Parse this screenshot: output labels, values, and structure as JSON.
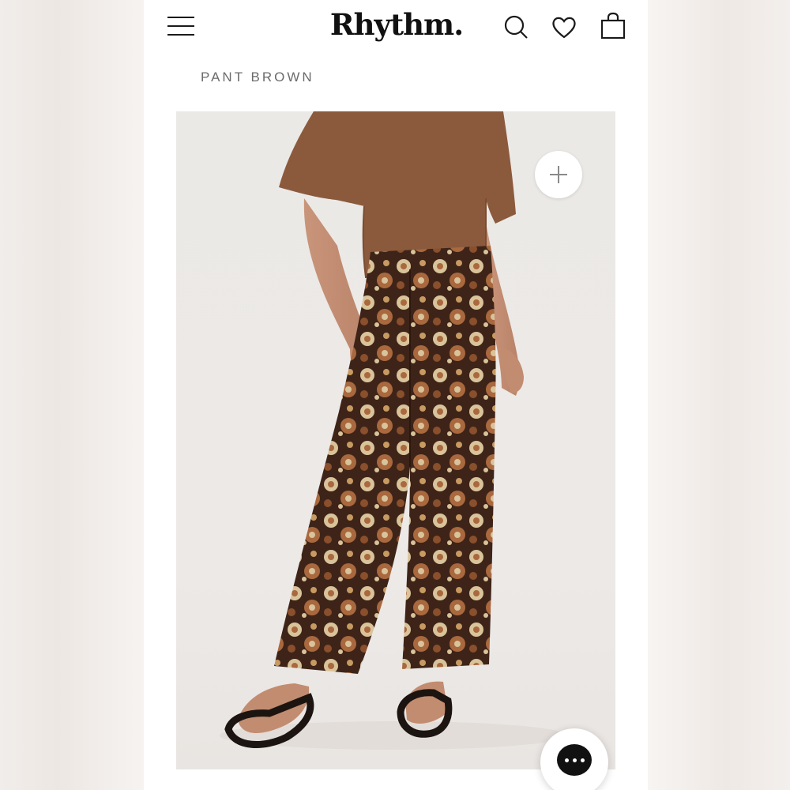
{
  "header": {
    "logo_text": "Rhythm.",
    "menu_icon": "hamburger-menu-icon",
    "search_icon": "search-icon",
    "wishlist_icon": "heart-icon",
    "cart_icon": "shopping-bag-icon"
  },
  "breadcrumb": {
    "label": "PANT BROWN"
  },
  "product": {
    "image_subject": "model wearing brown tee and floral wide-leg pants with strappy sandals",
    "zoom_icon": "plus-icon"
  },
  "chat": {
    "icon": "chat-bubble-icon"
  },
  "colors": {
    "tee": "#8b5a3c",
    "pants_base": "#3e2418",
    "floral_cream": "#d9c39a",
    "floral_rust": "#a9683e"
  }
}
